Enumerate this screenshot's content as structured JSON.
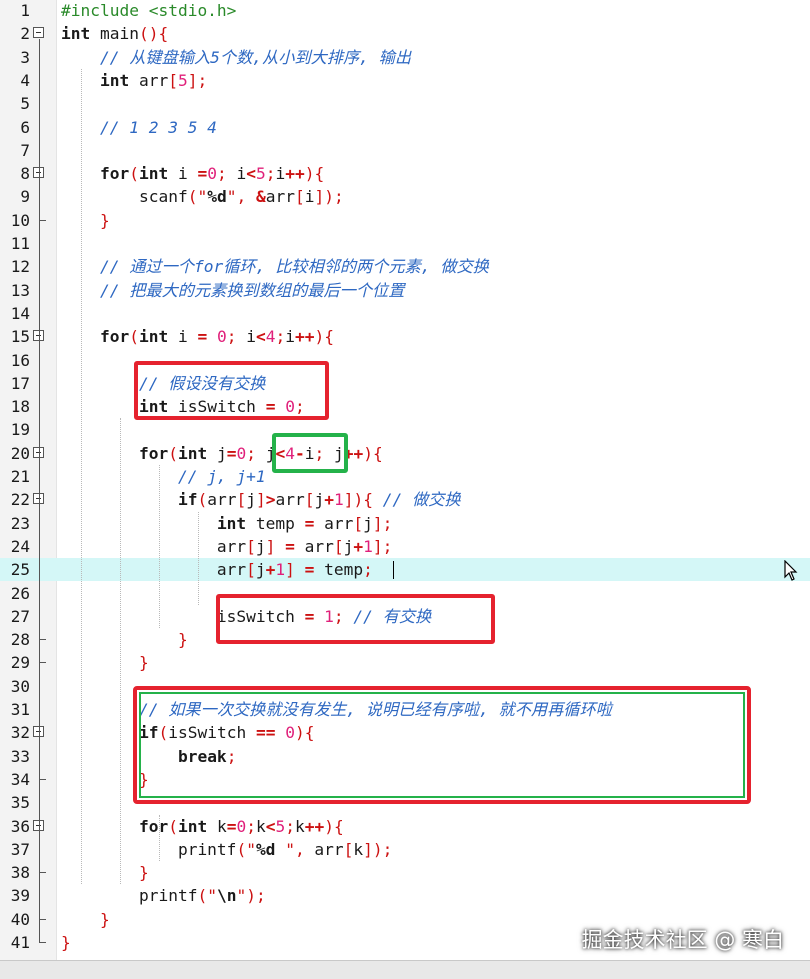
{
  "editor": {
    "lines": [
      {
        "n": "1",
        "t": "#include <stdio.h>"
      },
      {
        "n": "2",
        "t": "int main(){"
      },
      {
        "n": "3",
        "t": "    // 从键盘输入5个数,从小到大排序, 输出"
      },
      {
        "n": "4",
        "t": "    int arr[5];"
      },
      {
        "n": "5",
        "t": ""
      },
      {
        "n": "6",
        "t": "    // 1 2 3 5 4"
      },
      {
        "n": "7",
        "t": ""
      },
      {
        "n": "8",
        "t": "    for(int i =0; i<5;i++){"
      },
      {
        "n": "9",
        "t": "        scanf(\"%d\", &arr[i]);"
      },
      {
        "n": "10",
        "t": "    }"
      },
      {
        "n": "11",
        "t": ""
      },
      {
        "n": "12",
        "t": "    // 通过一个for循环, 比较相邻的两个元素, 做交换"
      },
      {
        "n": "13",
        "t": "    // 把最大的元素换到数组的最后一个位置"
      },
      {
        "n": "14",
        "t": ""
      },
      {
        "n": "15",
        "t": "    for(int i = 0; i<4;i++){"
      },
      {
        "n": "16",
        "t": ""
      },
      {
        "n": "17",
        "t": "        // 假设没有交换"
      },
      {
        "n": "18",
        "t": "        int isSwitch = 0;"
      },
      {
        "n": "19",
        "t": ""
      },
      {
        "n": "20",
        "t": "        for(int j=0; j<4-i; j++){"
      },
      {
        "n": "21",
        "t": "            // j, j+1"
      },
      {
        "n": "22",
        "t": "            if(arr[j]>arr[j+1]){ // 做交换"
      },
      {
        "n": "23",
        "t": "                int temp = arr[j];"
      },
      {
        "n": "24",
        "t": "                arr[j] = arr[j+1];"
      },
      {
        "n": "25",
        "t": "                arr[j+1] = temp;"
      },
      {
        "n": "26",
        "t": ""
      },
      {
        "n": "27",
        "t": "                isSwitch = 1; // 有交换"
      },
      {
        "n": "28",
        "t": "            }"
      },
      {
        "n": "29",
        "t": "        }"
      },
      {
        "n": "30",
        "t": ""
      },
      {
        "n": "31",
        "t": "        // 如果一次交换就没有发生, 说明已经有序啦, 就不用再循环啦"
      },
      {
        "n": "32",
        "t": "        if(isSwitch == 0){"
      },
      {
        "n": "33",
        "t": "            break;"
      },
      {
        "n": "34",
        "t": "        }"
      },
      {
        "n": "35",
        "t": ""
      },
      {
        "n": "36",
        "t": "        for(int k=0;k<5;k++){"
      },
      {
        "n": "37",
        "t": "            printf(\"%d \", arr[k]);"
      },
      {
        "n": "38",
        "t": "        }"
      },
      {
        "n": "39",
        "t": "        printf(\"\\n\");"
      },
      {
        "n": "40",
        "t": "    }"
      },
      {
        "n": "41",
        "t": "}"
      }
    ],
    "current_line": "25"
  },
  "watermark": "掘金技术社区 @ 寒白",
  "icons": {
    "fold": "fold-minus-icon",
    "pointer": "mouse-pointer-icon"
  },
  "colors": {
    "highlight_box_red": "#e5222e",
    "highlight_box_green": "#24b24a",
    "current_line_bg": "#d4f7f7",
    "comment": "#2e68c2",
    "number": "#e0207a"
  }
}
